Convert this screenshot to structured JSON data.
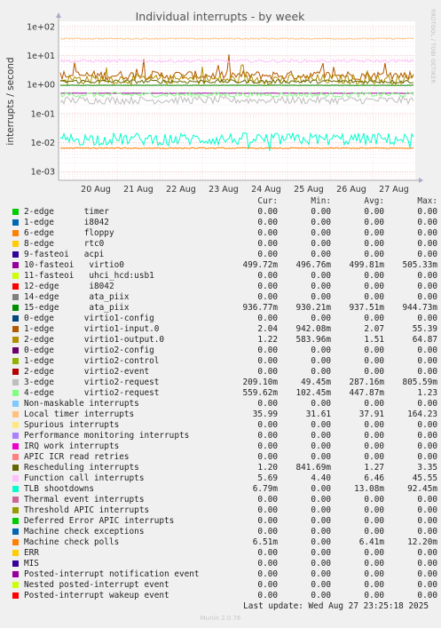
{
  "chart_data": {
    "type": "line",
    "title": "Individual interrupts - by week",
    "ylabel": "interrupts / second",
    "y_scale": "log",
    "ylim": [
      0.0005,
      150
    ],
    "y_ticks": [
      {
        "value": 0.001,
        "label": "1e-03"
      },
      {
        "value": 0.01,
        "label": "1e-02"
      },
      {
        "value": 0.1,
        "label": "1e-01"
      },
      {
        "value": 1,
        "label": "1e+00"
      },
      {
        "value": 10,
        "label": "1e+01"
      },
      {
        "value": 100,
        "label": "1e+02"
      }
    ],
    "x_ticks": [
      "20 Aug",
      "21 Aug",
      "22 Aug",
      "23 Aug",
      "24 Aug",
      "25 Aug",
      "26 Aug",
      "27 Aug"
    ],
    "grid": true,
    "legend_position": "bottom",
    "columns": [
      "Cur:",
      "Min:",
      "Avg:",
      "Max:"
    ],
    "series": [
      {
        "name": "2-edge      timer",
        "color": "#00cc00",
        "cur": "0.00",
        "min": "0.00",
        "avg": "0.00",
        "max": "0.00"
      },
      {
        "name": "1-edge      i8042",
        "color": "#0066b3",
        "cur": "0.00",
        "min": "0.00",
        "avg": "0.00",
        "max": "0.00"
      },
      {
        "name": "6-edge      floppy",
        "color": "#ff8000",
        "cur": "0.00",
        "min": "0.00",
        "avg": "0.00",
        "max": "0.00"
      },
      {
        "name": "8-edge      rtc0",
        "color": "#ffcc00",
        "cur": "0.00",
        "min": "0.00",
        "avg": "0.00",
        "max": "0.00"
      },
      {
        "name": "9-fasteoi   acpi",
        "color": "#330099",
        "cur": "0.00",
        "min": "0.00",
        "avg": "0.00",
        "max": "0.00"
      },
      {
        "name": "10-fasteoi   virtio0",
        "color": "#990099",
        "cur": "499.72m",
        "min": "496.76m",
        "avg": "499.81m",
        "max": "505.33m",
        "level": 0.5,
        "jitter": 0.01
      },
      {
        "name": "11-fasteoi   uhci_hcd:usb1",
        "color": "#ccff00",
        "cur": "0.00",
        "min": "0.00",
        "avg": "0.00",
        "max": "0.00"
      },
      {
        "name": "12-edge      i8042",
        "color": "#ff0000",
        "cur": "0.00",
        "min": "0.00",
        "avg": "0.00",
        "max": "0.00"
      },
      {
        "name": "14-edge      ata_piix",
        "color": "#808080",
        "cur": "0.00",
        "min": "0.00",
        "avg": "0.00",
        "max": "0.00"
      },
      {
        "name": "15-edge      ata_piix",
        "color": "#008f00",
        "cur": "936.77m",
        "min": "930.21m",
        "avg": "937.51m",
        "max": "944.73m",
        "level": 0.937,
        "jitter": 0.01
      },
      {
        "name": "0-edge      virtio1-config",
        "color": "#00487d",
        "cur": "0.00",
        "min": "0.00",
        "avg": "0.00",
        "max": "0.00"
      },
      {
        "name": "1-edge      virtio1-input.0",
        "color": "#b35a00",
        "cur": "2.04",
        "min": "942.08m",
        "avg": "2.07",
        "max": "55.39",
        "level": 2.07,
        "jitter": 0.35,
        "spikes": true
      },
      {
        "name": "2-edge      virtio1-output.0",
        "color": "#b38f00",
        "cur": "1.22",
        "min": "583.96m",
        "avg": "1.51",
        "max": "64.87",
        "level": 1.51,
        "jitter": 0.4,
        "spikes": true
      },
      {
        "name": "0-edge      virtio2-config",
        "color": "#6b006b",
        "cur": "0.00",
        "min": "0.00",
        "avg": "0.00",
        "max": "0.00"
      },
      {
        "name": "1-edge      virtio2-control",
        "color": "#8fb300",
        "cur": "0.00",
        "min": "0.00",
        "avg": "0.00",
        "max": "0.00"
      },
      {
        "name": "2-edge      virtio2-event",
        "color": "#b30000",
        "cur": "0.00",
        "min": "0.00",
        "avg": "0.00",
        "max": "0.00"
      },
      {
        "name": "3-edge      virtio2-request",
        "color": "#bebebe",
        "cur": "209.10m",
        "min": "49.45m",
        "avg": "287.16m",
        "max": "805.59m",
        "level": 0.287,
        "jitter": 0.3
      },
      {
        "name": "4-edge      virtio2-request",
        "color": "#80ff80",
        "cur": "559.62m",
        "min": "102.45m",
        "avg": "447.87m",
        "max": "1.23",
        "level": 0.448,
        "jitter": 0.2
      },
      {
        "name": "Non-maskable interrupts",
        "color": "#80c9ff",
        "cur": "0.00",
        "min": "0.00",
        "avg": "0.00",
        "max": "0.00"
      },
      {
        "name": "Local timer interrupts",
        "color": "#ffc080",
        "cur": "35.99",
        "min": "31.61",
        "avg": "37.91",
        "max": "164.23",
        "level": 37.91,
        "jitter": 0.05
      },
      {
        "name": "Spurious interrupts",
        "color": "#ffe680",
        "cur": "0.00",
        "min": "0.00",
        "avg": "0.00",
        "max": "0.00"
      },
      {
        "name": "Performance monitoring interrupts",
        "color": "#aa80ff",
        "cur": "0.00",
        "min": "0.00",
        "avg": "0.00",
        "max": "0.00"
      },
      {
        "name": "IRQ work interrupts",
        "color": "#ee00cc",
        "cur": "0.00",
        "min": "0.00",
        "avg": "0.00",
        "max": "0.00"
      },
      {
        "name": "APIC ICR read retries",
        "color": "#ff8080",
        "cur": "0.00",
        "min": "0.00",
        "avg": "0.00",
        "max": "0.00"
      },
      {
        "name": "Rescheduling interrupts",
        "color": "#666600",
        "cur": "1.20",
        "min": "841.69m",
        "avg": "1.27",
        "max": "3.35",
        "level": 1.27,
        "jitter": 0.15
      },
      {
        "name": "Function call interrupts",
        "color": "#ffbfff",
        "cur": "5.69",
        "min": "4.40",
        "avg": "6.46",
        "max": "45.55",
        "level": 6.46,
        "jitter": 0.12
      },
      {
        "name": "TLB shootdowns",
        "color": "#00ffcc",
        "cur": "6.79m",
        "min": "0.00",
        "avg": "13.08m",
        "max": "92.45m",
        "level": 0.01308,
        "jitter": 0.5,
        "dips": true
      },
      {
        "name": "Thermal event interrupts",
        "color": "#cc6699",
        "cur": "0.00",
        "min": "0.00",
        "avg": "0.00",
        "max": "0.00"
      },
      {
        "name": "Threshold APIC interrupts",
        "color": "#999900",
        "cur": "0.00",
        "min": "0.00",
        "avg": "0.00",
        "max": "0.00"
      },
      {
        "name": "Deferred Error APIC interrupts",
        "color": "#00cc00",
        "cur": "0.00",
        "min": "0.00",
        "avg": "0.00",
        "max": "0.00"
      },
      {
        "name": "Machine check exceptions",
        "color": "#0066b3",
        "cur": "0.00",
        "min": "0.00",
        "avg": "0.00",
        "max": "0.00"
      },
      {
        "name": "Machine check polls",
        "color": "#ff8000",
        "cur": "6.51m",
        "min": "0.00",
        "avg": "6.41m",
        "max": "12.20m",
        "level": 0.0064,
        "jitter": 0.04
      },
      {
        "name": "ERR",
        "color": "#ffcc00",
        "cur": "0.00",
        "min": "0.00",
        "avg": "0.00",
        "max": "0.00"
      },
      {
        "name": "MIS",
        "color": "#330099",
        "cur": "0.00",
        "min": "0.00",
        "avg": "0.00",
        "max": "0.00"
      },
      {
        "name": "Posted-interrupt notification event",
        "color": "#990099",
        "cur": "0.00",
        "min": "0.00",
        "avg": "0.00",
        "max": "0.00"
      },
      {
        "name": "Nested posted-interrupt event",
        "color": "#ccff00",
        "cur": "0.00",
        "min": "0.00",
        "avg": "0.00",
        "max": "0.00"
      },
      {
        "name": "Posted-interrupt wakeup event",
        "color": "#ff0000",
        "cur": "0.00",
        "min": "0.00",
        "avg": "0.00",
        "max": "0.00"
      }
    ]
  },
  "side_label": "RRDTOOL / TOBI OETIKER",
  "last_update": "Last update: Wed Aug 27 23:25:18 2025",
  "footer": "Munin 2.0.76"
}
